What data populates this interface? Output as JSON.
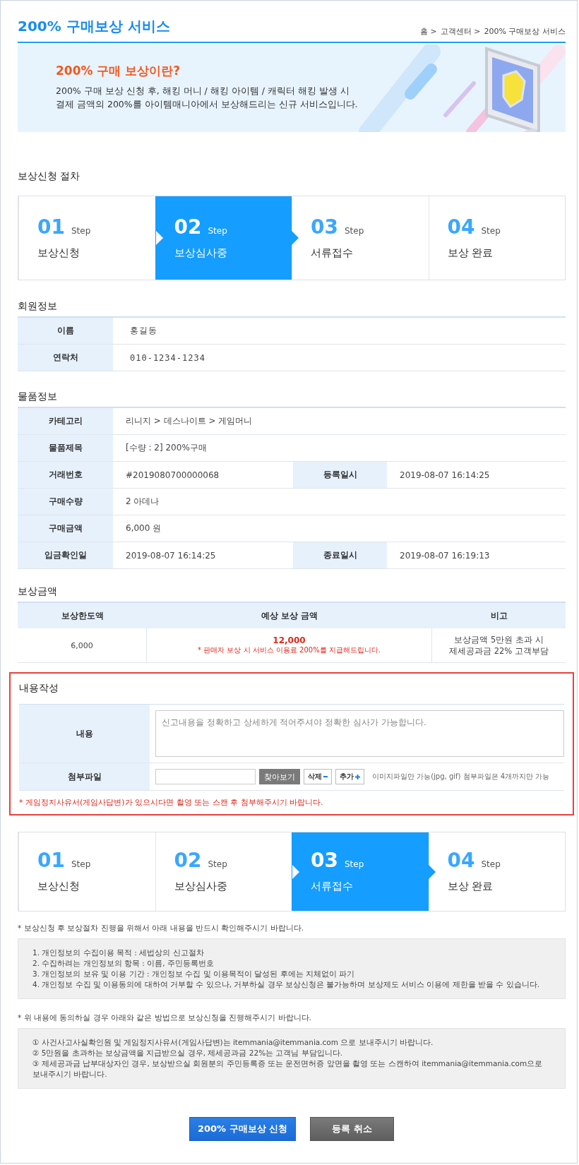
{
  "header": {
    "title": "200% 구매보상 서비스",
    "breadcrumb": [
      "홈 >",
      "고객센터 >",
      "200% 구매보상 서비스"
    ]
  },
  "banner": {
    "heading": "200% 구매 보상이란?",
    "lines": [
      "200% 구매 보상 신청 후, 해킹 머니 / 해킹 아이템 / 캐릭터 해킹 발생 시",
      "결제 금액의 200%를 아이템매니아에서 보상해드리는 신규 서비스입니다."
    ]
  },
  "procedure": {
    "title": "보상신청 절차",
    "steps": [
      {
        "number": "01",
        "unit": "Step",
        "label": "보상신청",
        "selected": false
      },
      {
        "number": "02",
        "unit": "Step",
        "label": "보상심사중",
        "selected": true
      },
      {
        "number": "03",
        "unit": "Step",
        "label": "서류접수",
        "selected": false
      },
      {
        "number": "04",
        "unit": "Step",
        "label": "보상 완료",
        "selected": false
      }
    ]
  },
  "member_info": {
    "title": "회원정보",
    "rows": [
      [
        {
          "label": "이름",
          "value": "홍길동"
        }
      ],
      [
        {
          "label": "연락처",
          "value": "010-1234-1234"
        }
      ]
    ]
  },
  "product_info": {
    "title": "물품정보",
    "rows": [
      [
        {
          "label": "카테고리",
          "value": "리니지 > 데스나이트 > 게임머니"
        }
      ],
      [
        {
          "label": "물품제목",
          "value": "[수량 : 2] 200%구매"
        }
      ],
      [
        {
          "label": "거래번호",
          "value": "#2019080700000068"
        },
        {
          "label": "등록일시",
          "value": "2019-08-07 16:14:25"
        }
      ],
      [
        {
          "label": "구매수량",
          "value": "2 아데나"
        }
      ],
      [
        {
          "label": "구매금액",
          "value": "6,000 원"
        }
      ],
      [
        {
          "label": "입금확인일",
          "value": "2019-08-07 16:14:25"
        },
        {
          "label": "종료일시",
          "value": "2019-08-07 16:19:13"
        }
      ]
    ]
  },
  "compensation": {
    "title": "보상금액",
    "columns": [
      "보상한도액",
      "예상 보상 금액",
      "비고"
    ],
    "row": {
      "limit": "6,000",
      "expected_amount": "12,000",
      "expected_note": "* 판매자 보상 시 서비스 이용료 200%를 지급해드립니다.",
      "remarks": [
        "보상금액 5만원 초과 시",
        "제세공과금 22% 고객부담"
      ]
    }
  },
  "content_form": {
    "title": "내용작성",
    "content": {
      "label": "내용",
      "placeholder": "신고내용을 정확하고 상세하게 적어주셔야 정확한 심사가 가능합니다."
    },
    "attachment": {
      "label": "첨부파일",
      "browse_button": "찾아보기",
      "delete_button": "삭제",
      "add_button": "추가",
      "hint": "이미지파일만 가능(jpg, gif) 첨부파일은 4개까지만 가능"
    },
    "warning": "* 게임정지사유서(게임사답변)가 있으시다면 촬영 또는 스캔 후 첨부해주시기 바랍니다."
  },
  "status_steps": [
    {
      "number": "01",
      "unit": "Step",
      "label": "보상신청",
      "selected": false
    },
    {
      "number": "02",
      "unit": "Step",
      "label": "보상심사중",
      "selected": false
    },
    {
      "number": "03",
      "unit": "Step",
      "label": "서류접수",
      "selected": true
    },
    {
      "number": "04",
      "unit": "Step",
      "label": "보상 완료",
      "selected": false
    }
  ],
  "notices": [
    {
      "caption": "* 보상신청 후 보상절차 진행을 위해서 아래 내용을 반드시 확인해주시기 바랍니다.",
      "items": [
        "1. 개인정보의 수집이용 목적 : 세법상의 신고절차",
        "2. 수집하려는 개인정보의 항목 : 이름, 주민등록번호",
        "3. 개인정보의 보유 및 이용 기간 : 개인정보 수집 및 이용목적이 달성된 후에는 지체없이 파기",
        "4. 개인정보 수집 및 이용동의에 대하여 거부할 수 있으나, 거부하실 경우 보상신청은 불가능하며 보상제도 서비스 이용에 제한을 받을 수 있습니다."
      ]
    },
    {
      "caption": "* 위 내용에 동의하실 경우 아래와 같은 방법으로 보상신청을 진행해주시기 바랍니다.",
      "items": [
        "① 사건사고사실확인원 및 게임정지사유서(게임사답변)는 itemmania@itemmania.com 으로 보내주시기 바랍니다.",
        "② 5만원을 초과하는 보상금액을 지급받으실 경우, 제세공과금 22%는 고객님 부담입니다.",
        "③ 제세공과금 납부대상자인 경우, 보상받으실 회원분의 주민등록증 또는 운전면허증 앞면을 촬영 또는 스캔하여 itemmania@itemmania.com으로 보내주시기 바랍니다."
      ]
    }
  ],
  "buttons": [
    {
      "label": "200% 구매보상 신청",
      "kind": "primary"
    },
    {
      "label": "등록 취소",
      "kind": "secondary"
    }
  ]
}
